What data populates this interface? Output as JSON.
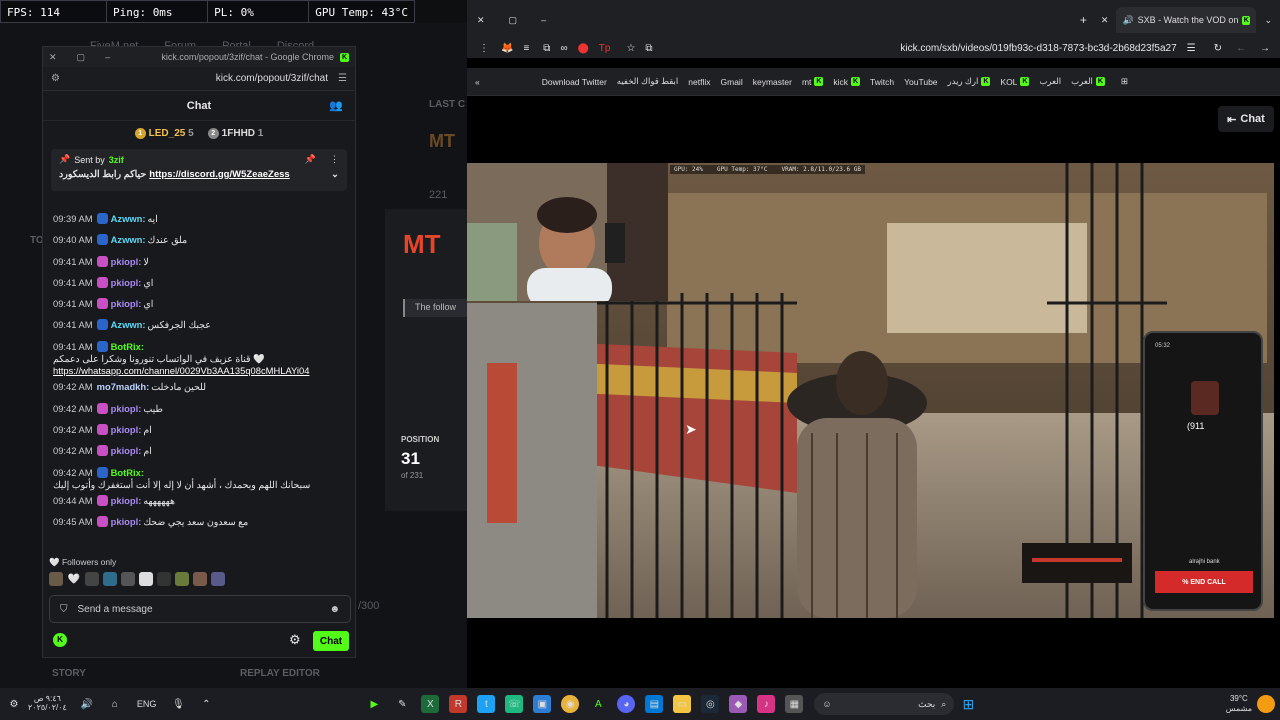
{
  "stats": {
    "fps": "FPS: 114",
    "ping": "Ping: 0ms",
    "pl": "PL: 0%",
    "gpu": "GPU Temp: 43°C"
  },
  "bg_page": {
    "nav": [
      "FiveM.net",
      "Forum",
      "Portal",
      "Discord"
    ],
    "last_label": "LAST C",
    "brand": "MT",
    "brand_side": "MT",
    "count": "221",
    "notice": "The follow",
    "position_label": "POSITION",
    "position_value": "31",
    "position_of": "of 231",
    "score": "/300",
    "story": "STORY",
    "replay": "REPLAY EDITOR",
    "to_label": "TO"
  },
  "chat_window": {
    "title": "kick.com/popout/3zif/chat - Google Chrome",
    "url": "kick.com/popout/3zif/chat",
    "header": "Chat",
    "leaders": [
      {
        "rank": "1",
        "name": "LED_25",
        "count": "5"
      },
      {
        "rank": "2",
        "name": "1FHHD",
        "count": "1"
      }
    ],
    "pinned": {
      "sent_by": "Sent by",
      "user": "3zif",
      "text": "حياكم رابط الديسكورد",
      "link": "https://discord.gg/W5ZeaeZess"
    },
    "messages": [
      {
        "time": "09:39 AM",
        "user": "Azwwn:",
        "color": "#5dd9f5",
        "text": "ايه",
        "badge": "#2a66c9"
      },
      {
        "time": "09:40 AM",
        "user": "Azwwn:",
        "color": "#5dd9f5",
        "text": "ملق عندك",
        "badge": "#2a66c9"
      },
      {
        "time": "09:41 AM",
        "user": "pkiopl:",
        "color": "#a98bf5",
        "text": "لا",
        "badge": "#c84fc4"
      },
      {
        "time": "09:41 AM",
        "user": "pkiopl:",
        "color": "#a98bf5",
        "text": "اي",
        "badge": "#c84fc4"
      },
      {
        "time": "09:41 AM",
        "user": "pkiopl:",
        "color": "#a98bf5",
        "text": "اي",
        "badge": "#c84fc4"
      },
      {
        "time": "09:41 AM",
        "user": "Azwwn:",
        "color": "#5dd9f5",
        "text": "عجبك الجرفكس",
        "badge": "#2a66c9"
      },
      {
        "time": "09:41 AM",
        "user": "BotRix:",
        "color": "#53fc18",
        "text": "قناة عزيف في الواتساب تنورونا وشكرا على دعمكم 🤍",
        "link": "https://whatsapp.com/channel/0029Vb3AA135q08cMHLAYi04",
        "badge": "#2a66c9"
      },
      {
        "time": "09:42 AM",
        "user": "mo7madkh:",
        "color": "#bcd3ff",
        "text": "للحين مادخلت",
        "badge": ""
      },
      {
        "time": "09:42 AM",
        "user": "pkiopl:",
        "color": "#a98bf5",
        "text": "طيب",
        "badge": "#c84fc4"
      },
      {
        "time": "09:42 AM",
        "user": "pkiopl:",
        "color": "#a98bf5",
        "text": "ام",
        "badge": "#c84fc4"
      },
      {
        "time": "09:42 AM",
        "user": "pkiopl:",
        "color": "#a98bf5",
        "text": "ام",
        "badge": "#c84fc4"
      },
      {
        "time": "09:42 AM",
        "user": "BotRix:",
        "color": "#53fc18",
        "text": "سبحانك اللهم وبحمدك ، أشهد أن لا إله إلا أنت أستغفرك وأتوب إليك",
        "badge": "#2a66c9"
      },
      {
        "time": "09:44 AM",
        "user": "pkiopl:",
        "color": "#a98bf5",
        "text": "ههههههه",
        "badge": "#c84fc4"
      },
      {
        "time": "09:45 AM",
        "user": "pkiopl:",
        "color": "#a98bf5",
        "text": "مع سعدون سعد يجي ضحك",
        "badge": "#c84fc4"
      }
    ],
    "followers_only": "Followers only",
    "input_placeholder": "Send a message",
    "send_label": "Chat"
  },
  "browser": {
    "tab_title": "SXB - Watch the VOD on K",
    "url": "kick.com/sxb/videos/019fb93c-d318-7873-bc3d-2b68d23f5a27",
    "bookmarks": [
      "Download Twitter",
      "ابقط قواك الخفيه",
      "netflix",
      "Gmail",
      "keymaster",
      "mt",
      "kick",
      "Twitch",
      "YouTube",
      "ارك ريدر",
      "KOL",
      "العرب",
      "العرب"
    ],
    "chat_button": "Chat"
  },
  "video": {
    "overlay_gpu": "GPU: 24%",
    "overlay_temp": "GPU Temp: 37°C",
    "overlay_vram": "VRAM: 2.8/11.0/23.6 GB",
    "phone_time": "05:32",
    "phone_number": "(911",
    "phone_bank": "alrajhi bank",
    "end_call": "% END CALL"
  },
  "taskbar": {
    "lang": "ENG",
    "time": "٩:٤٦ ص",
    "date": "٢٠٢٥/٠٢/٠٤",
    "temp": "39°C",
    "weather": "مشمس",
    "search": "بحث"
  }
}
